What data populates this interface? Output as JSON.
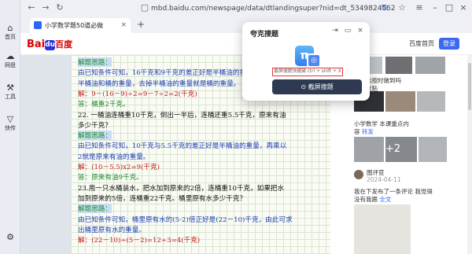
{
  "rail": [
    {
      "icon": "⌂",
      "label": "首页"
    },
    {
      "icon": "☁",
      "label": "网盘"
    },
    {
      "icon": "⚒",
      "label": "工具"
    },
    {
      "icon": "▽",
      "label": "快传"
    }
  ],
  "toolbar": {
    "url": "mbd.baidu.com/newspage/data/dtlandingsuper?nid=dt_534982456220920..."
  },
  "tab": {
    "title": "小学数学题50道必做",
    "close": "×",
    "add": "+"
  },
  "header": {
    "logo_text": "Bai",
    "logo_paw": "du",
    "logo_cn": "百度",
    "link": "百度首页",
    "login": "登录"
  },
  "article": {
    "lines": [
      {
        "text": "解题思路：",
        "cls": "green hl"
      },
      {
        "text": "由已知条件可知，16千克和9千克的差正好是半桶油的重量，",
        "cls": "blue"
      },
      {
        "text": "半桶油和桶的重量，去掉半桶油的重量就是桶的重量。",
        "cls": "blue"
      },
      {
        "text": "解：9－(16－9)÷2=9－7÷2=2(千克)",
        "cls": "red"
      },
      {
        "text": "答：桶重2千克。",
        "cls": "green"
      },
      {
        "text": "22. 一桶油连桶重10千克，倒出一半后，连桶还重5.5千克，原来有油",
        "cls": "black"
      },
      {
        "text": "多少千克？",
        "cls": "black"
      },
      {
        "text": "解题思路：",
        "cls": "green hl"
      },
      {
        "text": "由已知条件可知，10千克与5.5千克的差正好是半桶油的重量，再乘以",
        "cls": "blue"
      },
      {
        "text": "2就是原来有油的重量。",
        "cls": "blue"
      },
      {
        "text": "解：(10－5.5)x2=9(千克)",
        "cls": "red"
      },
      {
        "text": "答：原来有油9千克。",
        "cls": "green"
      },
      {
        "text": "23.用一只水桶装水，把水加到原来的2倍，连桶重10千克，如果把水",
        "cls": "black"
      },
      {
        "text": "加到原来的5倍，连桶重22千克。桶里原有水多少千克？",
        "cls": "black"
      },
      {
        "text": "解题思路：",
        "cls": "green hl"
      },
      {
        "text": "由已知条件可知，桶里原有水的(5-2)倍正好是(22－10)千克，由此可求",
        "cls": "blue"
      },
      {
        "text": "出桶里原有水的重量。",
        "cls": "blue"
      },
      {
        "text": "解：(22－10)÷(5－2)=12÷3=4(千克)",
        "cls": "red"
      }
    ]
  },
  "right": {
    "item1_a": "孩子能按时做到吗",
    "item1_b": "一张张贴",
    "item2_a": "小学数学 本课重点内",
    "item2_b": "容",
    "item2_c": "转发",
    "plus_count": "+2",
    "user": "图评官",
    "date": "2024-04-11",
    "post_a": "我在下发布了一条评论 我觉得",
    "post_b": "没有我跟",
    "share": "全文"
  },
  "popup": {
    "title": "夸克搜题",
    "logo": "π",
    "hint": "截屏搜题快捷键 ctrl + shift + X",
    "button": "⊙ 截屏搜题"
  }
}
